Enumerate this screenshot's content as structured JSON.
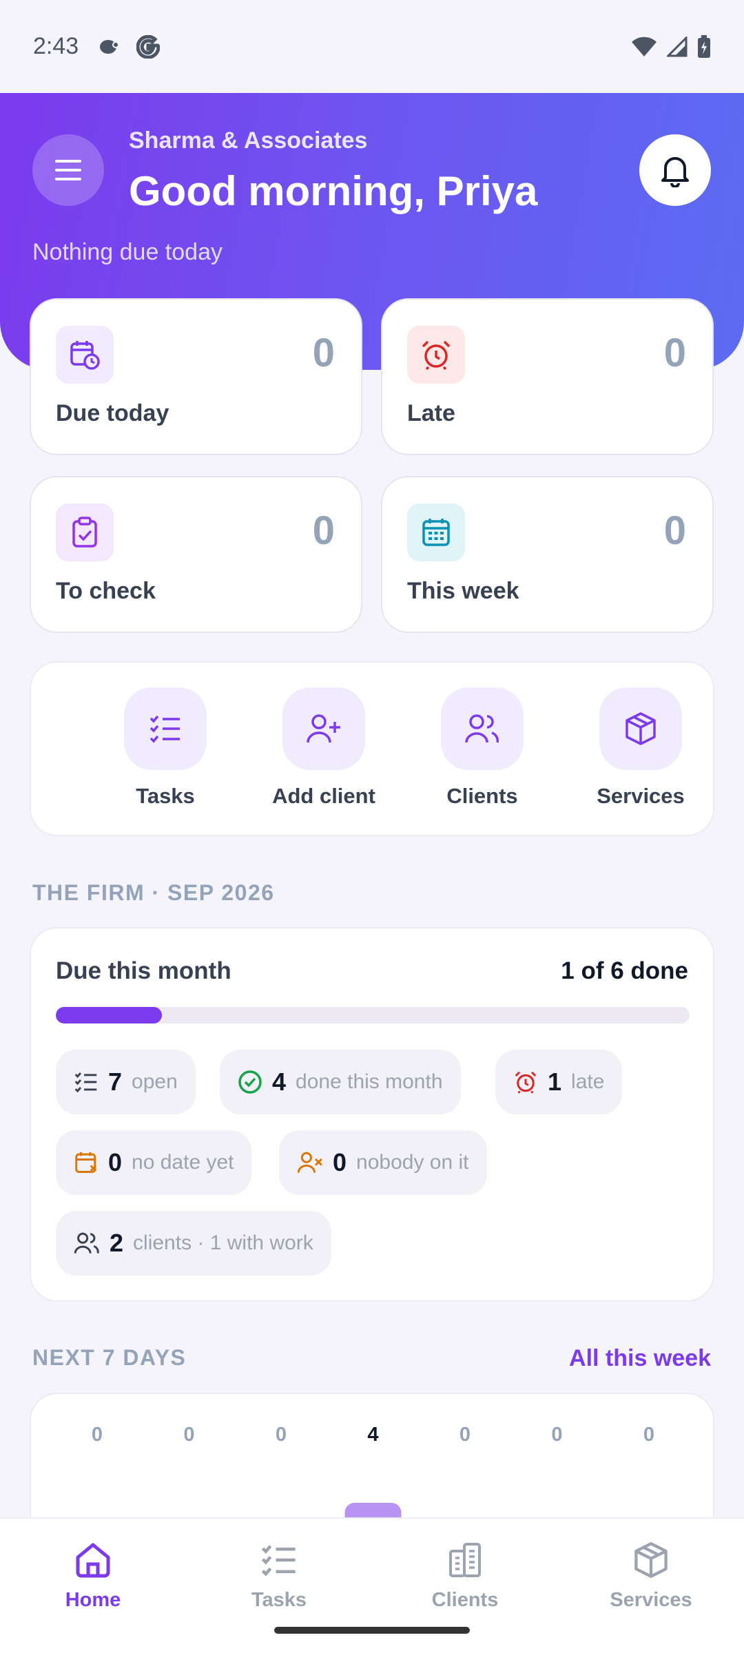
{
  "status_bar": {
    "time": "2:43"
  },
  "header": {
    "firm_name": "Sharma & Associates",
    "greeting": "Good morning, Priya",
    "subtitle": "Nothing due today"
  },
  "stats": [
    {
      "label": "Due today",
      "value": "0",
      "icon": "calendar-clock-icon",
      "accent": "#7c3aed",
      "bg": "#f1ebfd"
    },
    {
      "label": "Late",
      "value": "0",
      "icon": "alarm-clock-icon",
      "accent": "#dc2626",
      "bg": "#fde8e8"
    },
    {
      "label": "To check",
      "value": "0",
      "icon": "clipboard-check-icon",
      "accent": "#9333ea",
      "bg": "#f3e8fd"
    },
    {
      "label": "This week",
      "value": "0",
      "icon": "calendar-grid-icon",
      "accent": "#0891b2",
      "bg": "#e0f4f8"
    }
  ],
  "quick_actions": [
    {
      "label": "Tasks",
      "icon": "checklist-icon"
    },
    {
      "label": "Add client",
      "icon": "user-plus-icon"
    },
    {
      "label": "Clients",
      "icon": "users-icon"
    },
    {
      "label": "Services",
      "icon": "box-icon"
    }
  ],
  "firm_section": {
    "title": "THE FIRM · SEP 2026",
    "card_title": "Due this month",
    "done_text": "1 of 6 done",
    "progress": 0.167,
    "chips": [
      {
        "num": "7",
        "text": "open",
        "icon": "checklist-icon",
        "color": "#374151"
      },
      {
        "num": "4",
        "text": "done this month",
        "icon": "check-circle-icon",
        "color": "#16a34a"
      },
      {
        "num": "1",
        "text": "late",
        "icon": "alarm-clock-icon",
        "color": "#dc2626"
      },
      {
        "num": "0",
        "text": "no date yet",
        "icon": "calendar-x-icon",
        "color": "#d97706"
      },
      {
        "num": "0",
        "text": "nobody on it",
        "icon": "user-x-icon",
        "color": "#d97706"
      },
      {
        "num": "2",
        "text": "clients · 1 with work",
        "icon": "users-icon",
        "color": "#374151"
      }
    ]
  },
  "next_days": {
    "title": "NEXT 7 DAYS",
    "link": "All this week",
    "counts": [
      0,
      0,
      0,
      4,
      0,
      0,
      0
    ],
    "highlight_index": 3,
    "bar_color": "#b794f4"
  },
  "bottom_nav": [
    {
      "label": "Home",
      "icon": "home-icon",
      "active": true
    },
    {
      "label": "Tasks",
      "icon": "checklist-icon",
      "active": false
    },
    {
      "label": "Clients",
      "icon": "building-icon",
      "active": false
    },
    {
      "label": "Services",
      "icon": "box-icon",
      "active": false
    }
  ]
}
